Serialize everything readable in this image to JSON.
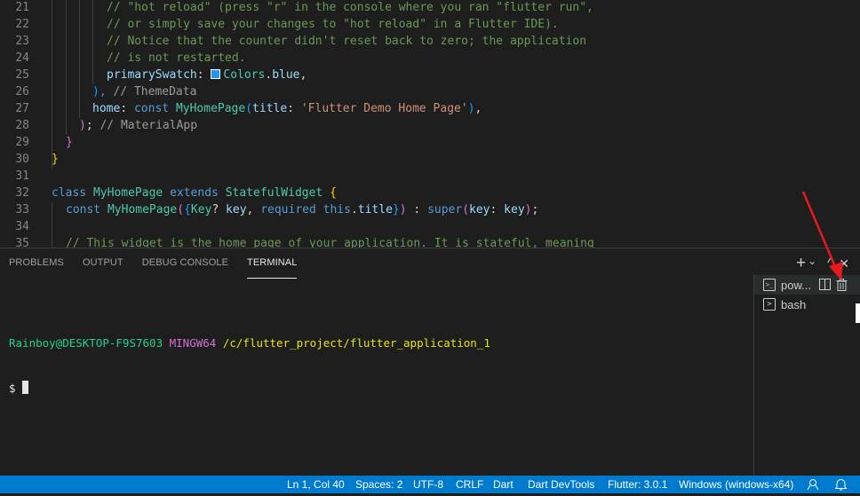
{
  "editor": {
    "lines": [
      {
        "n": "21",
        "tokens": [
          [
            "c-cm",
            "// \"hot reload\" (press \"r\" in the console where you ran \"flutter run\","
          ]
        ],
        "indent": 120
      },
      {
        "n": "22",
        "tokens": [
          [
            "c-cm",
            "// or simply save your changes to \"hot reload\" in a Flutter IDE)."
          ]
        ],
        "indent": 120
      },
      {
        "n": "23",
        "tokens": [
          [
            "c-cm",
            "// Notice that the counter didn't reset back to zero; the application"
          ]
        ],
        "indent": 120
      },
      {
        "n": "24",
        "tokens": [
          [
            "c-cm",
            "// is not restarted."
          ]
        ],
        "indent": 120
      },
      {
        "n": "25",
        "tokens": [
          [
            "c-pr",
            "primarySwatch"
          ],
          [
            "c-tx",
            ": "
          ],
          [
            "swatch",
            ""
          ],
          [
            "c-cl",
            "Colors"
          ],
          [
            "c-tx",
            "."
          ],
          [
            "c-pr",
            "blue"
          ],
          [
            "c-tx",
            ","
          ]
        ],
        "indent": 120
      },
      {
        "n": "26",
        "tokens": [
          [
            "c-p3",
            "),"
          ],
          [
            "c-hint",
            " // ThemeData"
          ]
        ],
        "indent": 104
      },
      {
        "n": "27",
        "tokens": [
          [
            "c-pr",
            "home"
          ],
          [
            "c-tx",
            ": "
          ],
          [
            "c-kw",
            "const "
          ],
          [
            "c-cl",
            "MyHomePage"
          ],
          [
            "c-p3",
            "("
          ],
          [
            "c-pr",
            "title"
          ],
          [
            "c-tx",
            ": "
          ],
          [
            "c-st",
            "'Flutter Demo Home Page'"
          ],
          [
            "c-p3",
            ")"
          ],
          [
            "c-tx",
            ","
          ]
        ],
        "indent": 104
      },
      {
        "n": "28",
        "tokens": [
          [
            "c-p2",
            ")"
          ],
          [
            "c-tx",
            ";"
          ],
          [
            "c-hint",
            " // MaterialApp"
          ]
        ],
        "indent": 89
      },
      {
        "n": "29",
        "tokens": [
          [
            "c-p2",
            "}"
          ]
        ],
        "indent": 74
      },
      {
        "n": "30",
        "tokens": [
          [
            "c-p1",
            "}"
          ]
        ],
        "indent": 58
      },
      {
        "n": "31",
        "tokens": [],
        "indent": 58
      },
      {
        "n": "32",
        "tokens": [
          [
            "c-kw",
            "class "
          ],
          [
            "c-cl",
            "MyHomePage "
          ],
          [
            "c-kw",
            "extends "
          ],
          [
            "c-cl",
            "StatefulWidget "
          ],
          [
            "c-p1",
            "{"
          ]
        ],
        "indent": 58
      },
      {
        "n": "33",
        "tokens": [
          [
            "c-kw",
            "const "
          ],
          [
            "c-cl",
            "MyHomePage"
          ],
          [
            "c-p2",
            "("
          ],
          [
            "c-p3",
            "{"
          ],
          [
            "c-cl",
            "Key"
          ],
          [
            "c-tx",
            "? "
          ],
          [
            "c-pr",
            "key"
          ],
          [
            "c-tx",
            ", "
          ],
          [
            "c-kw",
            "required "
          ],
          [
            "c-kw",
            "this"
          ],
          [
            "c-tx",
            "."
          ],
          [
            "c-pr",
            "title"
          ],
          [
            "c-p3",
            "}"
          ],
          [
            "c-p2",
            ")"
          ],
          [
            "c-tx",
            " : "
          ],
          [
            "c-kw",
            "super"
          ],
          [
            "c-p2",
            "("
          ],
          [
            "c-pr",
            "key"
          ],
          [
            "c-tx",
            ": "
          ],
          [
            "c-pr",
            "key"
          ],
          [
            "c-p2",
            ")"
          ],
          [
            "c-tx",
            ";"
          ]
        ],
        "indent": 74
      },
      {
        "n": "34",
        "tokens": [],
        "indent": 58
      },
      {
        "n": "35",
        "tokens": [
          [
            "c-cm",
            "// This widget is the home page of your application. It is stateful, meaning"
          ]
        ],
        "indent": 74
      }
    ]
  },
  "panel": {
    "tabs": [
      {
        "label": "PROBLEMS",
        "active": false
      },
      {
        "label": "OUTPUT",
        "active": false
      },
      {
        "label": "DEBUG CONSOLE",
        "active": false
      },
      {
        "label": "TERMINAL",
        "active": true
      }
    ],
    "actions": {
      "new_terminal": "+",
      "dropdown": "⌄",
      "maximize": "^",
      "close": "✕"
    },
    "terminal": {
      "user_host": "Rainboy@DESKTOP-F9S7603",
      "env": "MINGW64",
      "path": "/c/flutter_project/flutter_application_1",
      "prompt": "$"
    },
    "terminal_list": [
      {
        "label": "pow...",
        "icon": ">_",
        "selected": true
      },
      {
        "label": "bash",
        "icon": ">",
        "selected": false
      }
    ]
  },
  "status_bar": {
    "position": "Ln 1, Col 40",
    "spaces": "Spaces: 2",
    "encoding": "UTF-8",
    "eol": "CRLF",
    "language": "Dart",
    "devtools": "Dart DevTools",
    "flutter": "Flutter: 3.0.1",
    "device": "Windows (windows-x64)"
  },
  "colors": {
    "status_bar": "#007acc",
    "annotation_arrow": "#e8191f"
  }
}
